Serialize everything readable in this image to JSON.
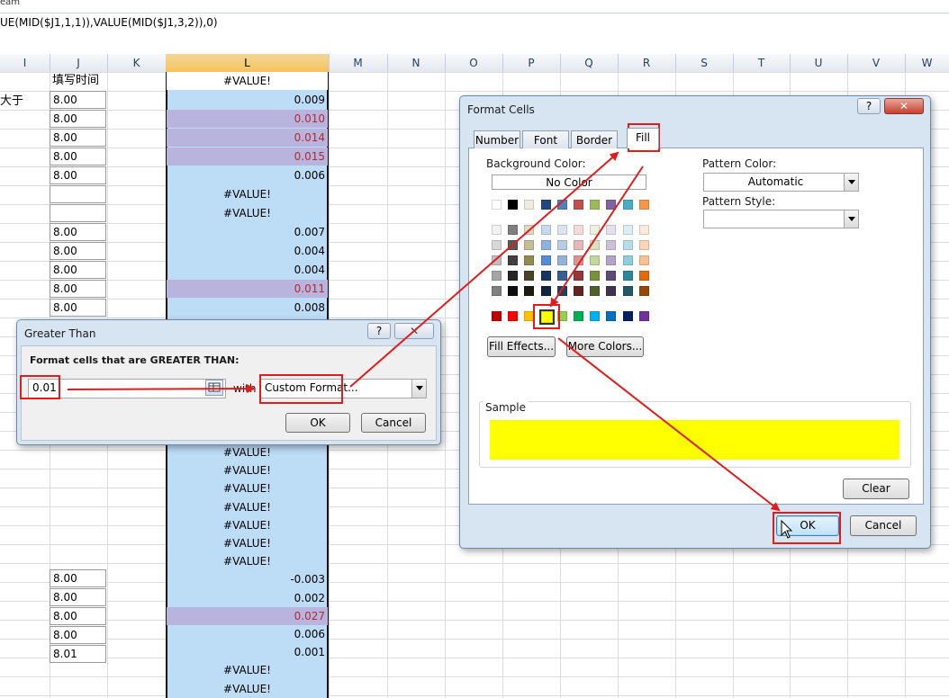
{
  "window": {
    "title_fragment": "eam"
  },
  "formula_bar": {
    "text": "UE(MID($J1,1,1)),VALUE(MID($J1,3,2)),0)"
  },
  "columns": [
    "I",
    "J",
    "K",
    "L",
    "M",
    "N",
    "O",
    "P",
    "Q",
    "R",
    "S",
    "T",
    "U",
    "V",
    "W"
  ],
  "sheet": {
    "col_i_text": "大于",
    "col_j_header": "填写时间",
    "col_j_values": [
      "8.00",
      "8.00",
      "8.00",
      "8.00",
      "8.00",
      "",
      "",
      "8.00",
      "8.00",
      "8.00",
      "8.00",
      "8.00"
    ],
    "col_j_values_lower": [
      "8.00",
      "8.00",
      "8.00",
      "8.00",
      "8.01"
    ],
    "col_l_upper": [
      {
        "value": "#VALUE!",
        "style": "white-err"
      },
      {
        "value": "0.009",
        "style": "norm"
      },
      {
        "value": "0.010",
        "style": "hi"
      },
      {
        "value": "0.014",
        "style": "hi"
      },
      {
        "value": "0.015",
        "style": "hi"
      },
      {
        "value": "0.006",
        "style": "norm"
      },
      {
        "value": "#VALUE!",
        "style": "err"
      },
      {
        "value": "#VALUE!",
        "style": "err"
      },
      {
        "value": "0.007",
        "style": "norm"
      },
      {
        "value": "0.004",
        "style": "norm"
      },
      {
        "value": "0.004",
        "style": "norm"
      },
      {
        "value": "0.011",
        "style": "hi"
      },
      {
        "value": "0.008",
        "style": "norm"
      }
    ],
    "col_l_lower": [
      {
        "value": "#VALUE!",
        "style": "err"
      },
      {
        "value": "#VALUE!",
        "style": "err"
      },
      {
        "value": "#VALUE!",
        "style": "err"
      },
      {
        "value": "#VALUE!",
        "style": "err"
      },
      {
        "value": "#VALUE!",
        "style": "err"
      },
      {
        "value": "#VALUE!",
        "style": "err"
      },
      {
        "value": "#VALUE!",
        "style": "err"
      },
      {
        "value": "-0.003",
        "style": "norm"
      },
      {
        "value": "0.002",
        "style": "norm"
      },
      {
        "value": "0.027",
        "style": "hi"
      },
      {
        "value": "0.006",
        "style": "norm"
      },
      {
        "value": "0.001",
        "style": "norm"
      },
      {
        "value": "#VALUE!",
        "style": "err"
      },
      {
        "value": "#VALUE!",
        "style": "err"
      }
    ]
  },
  "greater_than_dialog": {
    "title": "Greater Than",
    "help": "?",
    "close": "✕",
    "prompt": "Format cells that are GREATER THAN:",
    "value": "0.01",
    "with_label": "with",
    "format_select": "Custom Format...",
    "ok": "OK",
    "cancel": "Cancel"
  },
  "format_cells_dialog": {
    "title": "Format Cells",
    "help": "?",
    "close": "✕",
    "tabs": [
      "Number",
      "Font",
      "Border",
      "Fill"
    ],
    "active_tab": "Fill",
    "background_color_label": "Background Color:",
    "no_color": "No Color",
    "pattern_color_label": "Pattern Color:",
    "pattern_color_value": "Automatic",
    "pattern_style_label": "Pattern Style:",
    "pattern_style_value": "",
    "fill_effects": "Fill Effects...",
    "more_colors": "More Colors...",
    "sample_label": "Sample",
    "sample_color": "#ffff00",
    "clear": "Clear",
    "ok": "OK",
    "cancel": "Cancel",
    "theme_top_row": [
      "#ffffff",
      "#000000",
      "#eeece1",
      "#1f497d",
      "#4f81bd",
      "#c0504d",
      "#9bbb59",
      "#8064a2",
      "#4bacc6",
      "#f79646"
    ],
    "theme_shades": [
      [
        "#f2f2f2",
        "#7f7f7f",
        "#ddd9c3",
        "#c6d9f0",
        "#dbe5f1",
        "#f2dcdb",
        "#ebf1dd",
        "#e5e0ec",
        "#dbeef3",
        "#fdeada"
      ],
      [
        "#d8d8d8",
        "#595959",
        "#c4bd97",
        "#8db3e2",
        "#b8cce4",
        "#e5b9b7",
        "#d7e3bc",
        "#ccc1d9",
        "#b7dde8",
        "#fbd5b5"
      ],
      [
        "#bfbfbf",
        "#3f3f3f",
        "#938953",
        "#548dd4",
        "#95b3d7",
        "#d99694",
        "#c3d69b",
        "#b2a2c7",
        "#92cddc",
        "#fac08f"
      ],
      [
        "#a5a5a5",
        "#262626",
        "#494429",
        "#17365d",
        "#366092",
        "#953734",
        "#76923c",
        "#5f497a",
        "#31859b",
        "#e36c09"
      ],
      [
        "#7f7f7f",
        "#0c0c0c",
        "#1d1b10",
        "#0f243e",
        "#244061",
        "#632423",
        "#4f6128",
        "#3f3151",
        "#205867",
        "#974806"
      ]
    ],
    "standard_colors": [
      "#c00000",
      "#ff0000",
      "#ffc000",
      "#ffff00",
      "#92d050",
      "#00b050",
      "#00b0f0",
      "#0070c0",
      "#002060",
      "#7030a0"
    ],
    "selected_standard_index": 3
  },
  "colors": {
    "highlight_fill": "#b9b4dd",
    "normal_fill": "#bddcf6",
    "annotation_red": "#e01c1c"
  }
}
